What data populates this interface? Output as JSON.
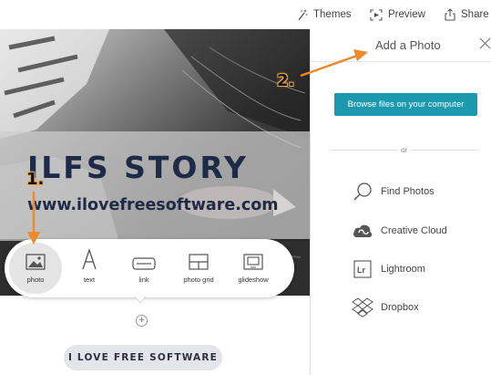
{
  "toolbar": {
    "themes_label": "Themes",
    "preview_label": "Preview",
    "share_label": "Share"
  },
  "story": {
    "title": "ILFS STORY",
    "url": "www.ilovefreesoftware.com",
    "footer_label": "I LOVE FREE SOFTWARE"
  },
  "insert_bar": {
    "items": [
      {
        "label": "photo",
        "icon": "photo-icon"
      },
      {
        "label": "text",
        "icon": "text-icon"
      },
      {
        "label": "link",
        "icon": "link-icon"
      },
      {
        "label": "photo grid",
        "icon": "photo-grid-icon"
      },
      {
        "label": "glideshow",
        "icon": "glideshow-icon"
      }
    ],
    "add_symbol": "+"
  },
  "panel": {
    "title": "Add a Photo",
    "browse_label": "Browse files on your computer",
    "or_label": "or",
    "sources": [
      {
        "label": "Find Photos",
        "icon": "search-icon"
      },
      {
        "label": "Creative Cloud",
        "icon": "creative-cloud-icon"
      },
      {
        "label": "Lightroom",
        "icon": "lightroom-icon"
      },
      {
        "label": "Dropbox",
        "icon": "dropbox-icon"
      }
    ]
  },
  "annotations": {
    "step1": "1.",
    "step2": "2."
  },
  "colors": {
    "accent": "#1c99ae",
    "title_text": "#1e2a47",
    "arrow": "#ee8a2a"
  }
}
